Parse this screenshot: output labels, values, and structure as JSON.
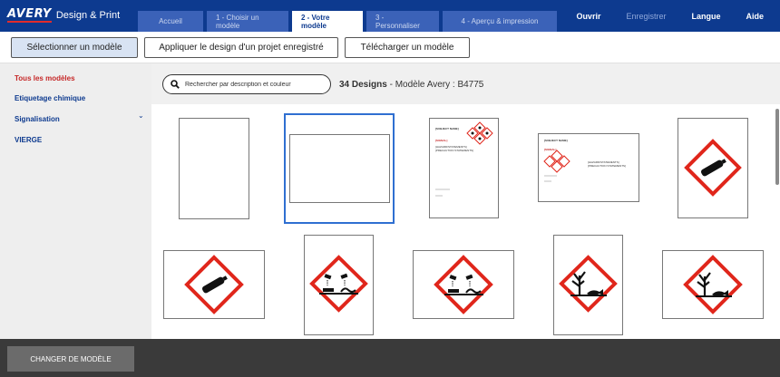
{
  "header": {
    "logo_mark": "AVERY",
    "logo_text": "Design & Print",
    "tabs": [
      {
        "label": "Accueil"
      },
      {
        "label": "1 - Choisir un modèle"
      },
      {
        "label": "2 - Votre modèle"
      },
      {
        "label": "3 - Personnaliser"
      },
      {
        "label": "4 - Aperçu & impression"
      }
    ],
    "nav": {
      "open": "Ouvrir",
      "save": "Enregistrer",
      "language": "Langue",
      "help": "Aide"
    }
  },
  "actions": {
    "select_template": "Sélectionner un modèle",
    "apply_design": "Appliquer le design d'un projet enregistré",
    "upload_template": "Télécharger un modèle"
  },
  "sidebar": {
    "items": [
      {
        "label": "Tous les modèles"
      },
      {
        "label": "Etiquetage chimique"
      },
      {
        "label": "Signalisation"
      },
      {
        "label": "VIERGE"
      }
    ]
  },
  "search": {
    "placeholder": "Rechercher par description et couleur"
  },
  "results": {
    "count": "34 Designs",
    "model": " - Modèle Avery : B4775"
  },
  "thumbnails": {
    "subject_name": "[SUBJECT NAME]",
    "signal": "[SIGNAL]",
    "hazard": "[HAZARD/STATEMENTS]",
    "precaution": "[PRECAUTION STATEMENTS]"
  },
  "footer": {
    "change_model": "CHANGER DE MODÈLE"
  },
  "colors": {
    "brand": "#0d3a8f",
    "hazard_red": "#e0261b",
    "selected": "#2f6fd1"
  }
}
